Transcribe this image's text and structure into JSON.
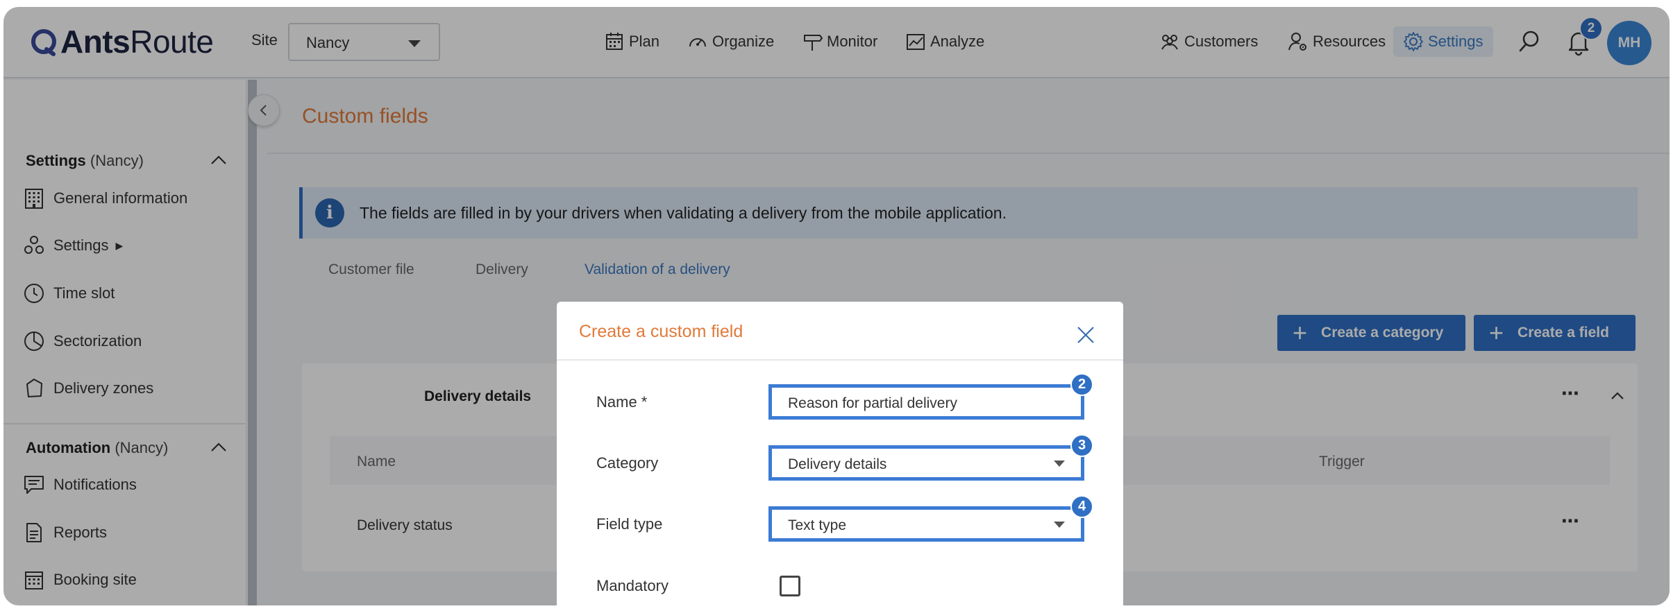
{
  "header": {
    "logo_bold": "Ants",
    "logo_light": "Route",
    "site_label": "Site",
    "site_value": "Nancy",
    "nav": [
      {
        "label": "Plan",
        "icon": "calendar-icon"
      },
      {
        "label": "Organize",
        "icon": "gauge-icon"
      },
      {
        "label": "Monitor",
        "icon": "signpost-icon"
      },
      {
        "label": "Analyze",
        "icon": "chart-line-icon"
      }
    ],
    "right_nav": [
      {
        "label": "Customers",
        "icon": "people-icon"
      },
      {
        "label": "Resources",
        "icon": "user-gear-icon"
      },
      {
        "label": "Settings",
        "icon": "gear-icon",
        "active": true
      }
    ],
    "notification_count": "2",
    "avatar_initials": "MH"
  },
  "sidebar": {
    "section1": {
      "title": "Settings",
      "context": "(Nancy)"
    },
    "items1": [
      {
        "label": "General information",
        "icon": "building-icon"
      },
      {
        "label": "Settings",
        "icon": "cubes-icon",
        "arrow": "▶"
      },
      {
        "label": "Time slot",
        "icon": "clock-icon"
      },
      {
        "label": "Sectorization",
        "icon": "pie-chart-icon"
      },
      {
        "label": "Delivery zones",
        "icon": "polygon-icon"
      }
    ],
    "section2": {
      "title": "Automation",
      "context": "(Nancy)"
    },
    "items2": [
      {
        "label": "Notifications",
        "icon": "message-icon"
      },
      {
        "label": "Reports",
        "icon": "document-icon"
      },
      {
        "label": "Booking site",
        "icon": "calendar-grid-icon"
      }
    ]
  },
  "main": {
    "title": "Custom fields",
    "info": "The fields are filled in by your drivers when validating a delivery from the mobile application.",
    "tabs": [
      "Customer file",
      "Delivery",
      "Validation of a delivery"
    ],
    "active_tab": 2,
    "create_category": "Create a category",
    "create_field": "Create a field",
    "card": {
      "title": "Delivery details",
      "columns": [
        "Name",
        "Trigger"
      ],
      "rows": [
        {
          "name": "Delivery status"
        }
      ]
    }
  },
  "modal": {
    "title": "Create a custom field",
    "fields": [
      {
        "label": "Name *",
        "value": "Reason for partial delivery",
        "step": "2"
      },
      {
        "label": "Category",
        "value": "Delivery details",
        "step": "3"
      },
      {
        "label": "Field type",
        "value": "Text type",
        "step": "4"
      }
    ],
    "mandatory_label": "Mandatory",
    "mandatory_checked": false
  },
  "colors": {
    "accent": "#2f6fc4",
    "title_orange": "#e07a3a",
    "highlight": "#3c7bd4"
  }
}
